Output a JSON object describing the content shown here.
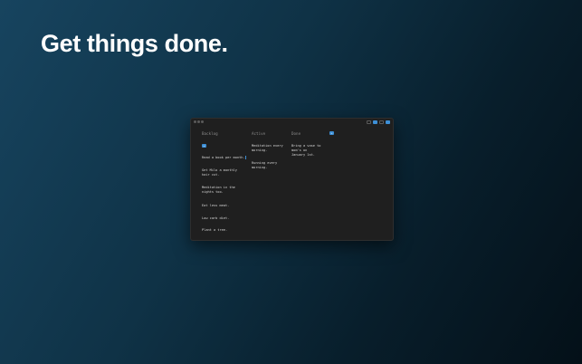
{
  "headline": "Get things done.",
  "window": {
    "toolbar": {
      "icons": [
        "sidebar-icon",
        "new-icon",
        "view-icon",
        "share-icon"
      ],
      "accent": "#3d8fd6"
    },
    "columns": [
      {
        "title": "Backlog",
        "add_label": "+",
        "cards": [
          "Read a book per month.",
          "Get Milo a monthly\nhair cut.",
          "Meditation in the\nnights too.",
          "Eat less meat.",
          "Low carb diet.",
          "Plant a tree."
        ]
      },
      {
        "title": "Active",
        "cards": [
          "Meditation every\nmorning.",
          "Running every\nmorning."
        ]
      },
      {
        "title": "Done",
        "add_label": "+",
        "cards": [
          "Bring a vase to\nmom's on\nJanuary 1st."
        ]
      }
    ]
  }
}
